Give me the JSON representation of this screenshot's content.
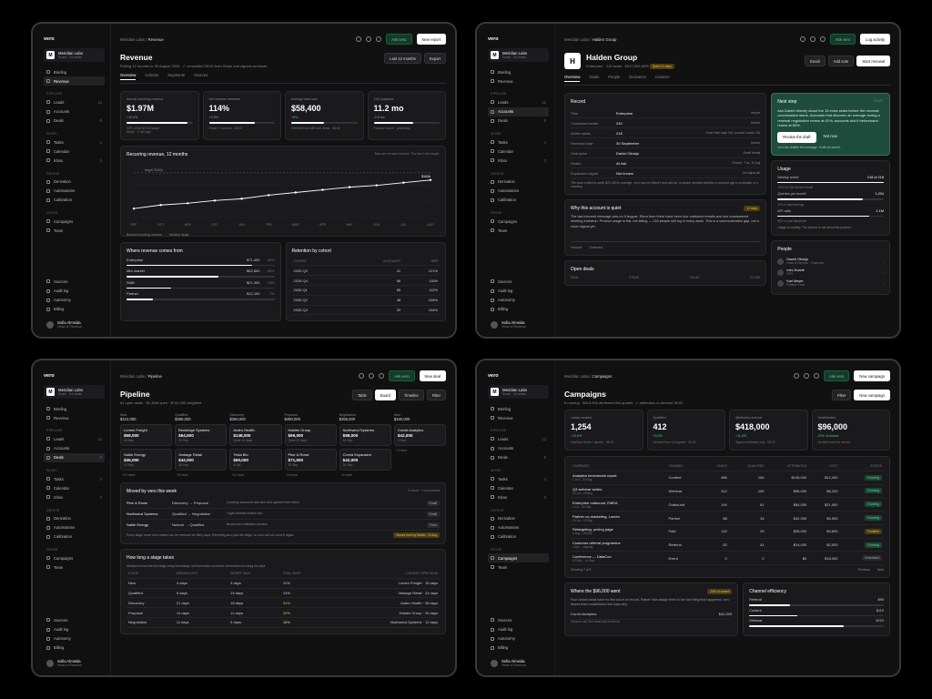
{
  "sidebar": {
    "logo": "vero",
    "workspace": "Meridian Labs",
    "workspace_sub": "Scale · 24 seats",
    "items_top": [
      {
        "label": "Briefing"
      },
      {
        "label": "Revenue"
      }
    ],
    "pipeline_label": "PIPELINE",
    "pipeline_items": [
      {
        "label": "Leads",
        "count": "12"
      },
      {
        "label": "Accounts",
        "count": ""
      },
      {
        "label": "Deals",
        "count": "8"
      }
    ],
    "work_label": "WORK",
    "work_items": [
      {
        "label": "Tasks",
        "count": "4"
      },
      {
        "label": "Calendar"
      },
      {
        "label": "Inbox",
        "count": "3"
      }
    ],
    "derive_label": "DERIVE",
    "derive_items": [
      {
        "label": "Derivation"
      },
      {
        "label": "Automations"
      },
      {
        "label": "Calibration"
      }
    ],
    "grow_label": "GROW",
    "grow_items": [
      {
        "label": "Campaigns"
      },
      {
        "label": "Team"
      }
    ],
    "bottom_items": [
      {
        "label": "Sources"
      },
      {
        "label": "Audit log"
      },
      {
        "label": "Autonomy"
      },
      {
        "label": "Billing"
      }
    ],
    "user_name": "Sofia Almeida",
    "user_role": "Head of Revenue"
  },
  "top": {
    "ask": "Ask vero"
  },
  "revenue": {
    "crumb_root": "Meridian Labs",
    "crumb": "Revenue",
    "new": "New report",
    "title": "Revenue",
    "subtitle": "Rolling 12 months to 30 August 2026",
    "reconciled": "reconciled 06:02 from Stripe and signed contracts",
    "range": "Last 12 months",
    "export": "Export",
    "tabs": [
      "Overview",
      "Cohorts",
      "Segments",
      "Sources"
    ],
    "kpis": [
      {
        "label": "Annual recurring revenue",
        "value": "$1.97M",
        "delta": "+12.4%",
        "foot": "Stripe · 2 min ago",
        "note": "92% of the $2.1M target",
        "fill": 0.92
      },
      {
        "label": "Net revenue retention",
        "value": "114%",
        "delta": "+2.6%",
        "foot": "Stripe + invoices · 06:02",
        "fill": 0.7
      },
      {
        "label": "Average deal size",
        "value": "$58,400",
        "delta": "+8%",
        "foot": "Derived from 286 won deals · 06:02",
        "fill": 0.5
      },
      {
        "label": "CAC payback",
        "value": "11.2 mo",
        "delta": "-0.8 mo",
        "foot": "Finance export · yesterday",
        "fill": 0.6
      }
    ],
    "chart_title": "Recurring revenue, 12 months",
    "chart_note": "Bars are revised revenue. The line is the target.",
    "legend_a": "Booked recurring revenue",
    "legend_b": "Monthly target",
    "target_label": "target $180k",
    "end_label": "$164k",
    "chart_data": {
      "type": "line",
      "categories": [
        "SEP",
        "OCT",
        "NOV",
        "DEC",
        "JAN",
        "FEB",
        "MAR",
        "APR",
        "MAY",
        "JUN",
        "JUL",
        "AUG"
      ],
      "values": [
        100,
        108,
        112,
        118,
        122,
        130,
        136,
        142,
        148,
        152,
        158,
        164
      ]
    },
    "where_title": "Where revenue comes from",
    "where": [
      {
        "name": "Enterprise",
        "value": "$71,400",
        "pct": "42%",
        "fill": 0.85
      },
      {
        "name": "Mid-market",
        "value": "$52,800",
        "pct": "33%",
        "fill": 0.62
      },
      {
        "name": "SMB",
        "value": "$21,300",
        "pct": "13%",
        "fill": 0.3
      },
      {
        "name": "Partner",
        "value": "$12,100",
        "pct": "7%",
        "fill": 0.18
      }
    ],
    "cohort_title": "Retention by cohort",
    "cohort_cols": [
      "COHORT",
      "ACCOUNTS",
      "NRR"
    ],
    "cohorts": [
      [
        "2025 Q3",
        "41",
        "121%"
      ],
      [
        "2025 Q4",
        "58",
        "116%"
      ],
      [
        "2026 Q1",
        "65",
        "112%"
      ],
      [
        "2026 Q2",
        "38",
        "108%"
      ],
      [
        "2026 Q3",
        "29",
        "104%"
      ]
    ]
  },
  "account": {
    "crumb_root": "Meridian Labs",
    "crumb": "Halden Group",
    "activity": "Log activity",
    "title": "Halden Group",
    "meta": "Enterprise · 218 seats · $312,000 ARR",
    "badge": "Quiet 12 days",
    "email": "Email",
    "note": "Add note",
    "renew": "Start renewal",
    "tabs": [
      "Overview",
      "Deals",
      "People",
      "Derivation",
      "Invoices"
    ],
    "record_title": "Record",
    "record": [
      {
        "k": "Plan",
        "v": "Enterprise",
        "s": "Invoice"
      },
      {
        "k": "Contracted seats",
        "v": "240",
        "s": "Invoice"
      },
      {
        "k": "Active seats",
        "v": "218",
        "s": "Order form says 240, product counts 218"
      },
      {
        "k": "Renewal date",
        "v": "30 September",
        "s": "Invoice"
      },
      {
        "k": "Champion",
        "v": "Daniel Okonjo",
        "s": "Email thread"
      },
      {
        "k": "Health",
        "v": "At risk",
        "s": "Flowed · Tue, 11 Aug"
      },
      {
        "k": "Expansion signal",
        "v": "Not known",
        "s": "No signal yet"
      }
    ],
    "record_note": "The seat conflict is worth $23,400 in overage. vero has not billed it and will not, a person decides whether a contract gap is a mistake or a courtesy.",
    "quiet_title": "Why this account is quiet",
    "quiet_badge": "12 days",
    "quiet_text": "The last inbound message was on 5 August. Since then there have been four outbound emails and one unanswered meeting invitation. Product usage is flat, not falling — 218 people still log in every week. This is a communication gap, not a churn signal yet.",
    "quiet_a": "Inbound",
    "quiet_b": "Outbound",
    "deals_title": "Open deals",
    "deals_cols": [
      "DEAL",
      "STAGE",
      "VALUE",
      "CLOSE"
    ],
    "next_title": "Next step",
    "next_tag": "DRAFT",
    "next_text": "Ask Daniel directly about the 15 extra seats before the renewal conversation starts. Accounts that discover an overage during a renewal negotiation renew at 61%; accounts told it beforehand renew at 83%.",
    "next_btn": "Review the draft",
    "next_btn2": "Not now",
    "next_foot": "vero has drafted the message. It will not send it.",
    "usage_title": "Usage",
    "usage": [
      {
        "k": "Weekly active",
        "v": "218 of 218",
        "n": "100% of 218 licensed seats",
        "fill": 1
      },
      {
        "k": "Queries per month",
        "v": "1,204",
        "n": "11% of past average",
        "fill": 0.8
      },
      {
        "k": "API calls",
        "v": "2.1M",
        "n": "86% of past allowance",
        "fill": 0.86
      }
    ],
    "usage_note": "Usage is healthy. The silence is not about the product.",
    "people_title": "People",
    "people": [
      {
        "n": "Daniel Okonjo",
        "r": "Head of RevOps · Champion"
      },
      {
        "n": "Ines Duarte",
        "r": "CFO"
      },
      {
        "n": "Karl Meyer",
        "r": "Platform Lead"
      }
    ]
  },
  "pipeline": {
    "crumb_root": "Meridian Labs",
    "crumb": "Pipeline",
    "new": "New deal",
    "title": "Pipeline",
    "subtitle": "61 open deals · $1.46M open · $744,000 weighted",
    "views": [
      "Table",
      "Board",
      "Timeline"
    ],
    "filter": "Filter",
    "cols": [
      {
        "h": "New",
        "v": "$410,000",
        "cards": [
          {
            "n": "Lumen Freight",
            "v": "$58,000",
            "m": "15 Sep"
          },
          {
            "n": "Sable Energy",
            "v": "$36,000",
            "m": "12 Sep"
          }
        ],
        "more": "+10 more"
      },
      {
        "h": "Qualified",
        "v": "$286,000",
        "cards": [
          {
            "n": "Beckridge Systems",
            "v": "$64,500",
            "m": "22 Sep"
          },
          {
            "n": "Vantage Retail",
            "v": "$42,000",
            "m": "28 Sep"
          }
        ],
        "more": "+8 more"
      },
      {
        "h": "Discovery",
        "v": "$366,000",
        "cards": [
          {
            "n": "Arden Health",
            "v": "$148,000",
            "m": "Quiet 16 days"
          },
          {
            "n": "Tesla Bio",
            "v": "$60,000",
            "m": "9 Oct"
          }
        ],
        "more": "+11 more"
      },
      {
        "h": "Proposal",
        "v": "$490,000",
        "cards": [
          {
            "n": "Halden Group",
            "v": "$99,000",
            "m": "Quiet 12 days"
          },
          {
            "n": "Pine & Rowe",
            "v": "$71,500",
            "m": "30 Sep"
          }
        ],
        "more": "+5 more"
      },
      {
        "h": "Negotiation",
        "v": "$356,000",
        "cards": [
          {
            "n": "Northwind Systems",
            "v": "$88,000",
            "m": "14 Sep"
          },
          {
            "n": "Corvid Expansion",
            "v": "$42,000",
            "m": "20 Sep"
          }
        ],
        "more": "+4 more"
      },
      {
        "h": "Won",
        "v": "$180,000",
        "cards": [
          {
            "n": "Corvid Analytics",
            "v": "$42,000",
            "m": "3 Sep"
          }
        ],
        "more": "+3 more"
      }
    ],
    "moved_title": "Moved by vero this week",
    "moved_meta": "3 moves · 1 unresolved",
    "moved": [
      {
        "n": "Pine & Rowe",
        "s": "Discovery → Proposal",
        "r": "A pricing document was sent and opened three times",
        "src": "Email"
      },
      {
        "n": "Northwind Systems",
        "s": "Qualified → Negotiation",
        "r": "Legal redlined section two",
        "src": "Email"
      },
      {
        "n": "Sable Energy",
        "s": "Nurture → Qualified",
        "r": "Booked an evaluation session",
        "src": "Form"
      }
    ],
    "moved_note": "Every stage move vero makes can be reversed for thirty days. Reverting also puts the stage, so vero will not move it again.",
    "moved_badge": "Moves held by Martin, 74 Aug",
    "stage_title": "How long a stage takes",
    "stage_sub": "Measured from the first stage entry timestamp, not from when someone remembered to drag the card.",
    "stage_cols": [
      "STAGE",
      "MEDIAN DAYS",
      "WORST DAYS",
      "STALL RATE",
      "LONGEST OPEN NOW"
    ],
    "stages": [
      [
        "New",
        "4 days",
        "3 days",
        "11%",
        "Lumen Freight · 16 days"
      ],
      [
        "Qualified",
        "9 days",
        "14 days",
        "14%",
        "Vantage Retail · 24 days"
      ],
      [
        "Discovery",
        "21 days",
        "18 days",
        "31%",
        "Arden Health · 36 days"
      ],
      [
        "Proposal",
        "14 days",
        "11 days",
        "22%",
        "Halden Group · 30 days"
      ],
      [
        "Negotiation",
        "11 days",
        "9 days",
        "18%",
        "Northwind Systems · 12 days"
      ]
    ]
  },
  "campaigns": {
    "crumb_root": "Meridian Labs",
    "crumb": "Campaigns",
    "new": "New campaign",
    "title": "Campaigns",
    "subtitle": "6 running · $418,000 attributed this quarter",
    "attr": "attribution re-derived 06:02",
    "filter": "Filter",
    "new2": "New campaign",
    "kpis": [
      {
        "l": "Leads created",
        "v": "1,254",
        "d": "+14.0%",
        "f": "HubSpot forms + Apollo · 06:02"
      },
      {
        "l": "Qualified",
        "v": "412",
        "d": "+8.2%",
        "f": "Derived from 14 signals · 06:02"
      },
      {
        "l": "Attributed revenue",
        "v": "$418,000",
        "d": "+11.4%",
        "f": "Signed contracts only · 06:02"
      },
      {
        "l": "Unattributed",
        "v": "$96,000",
        "d": "23% of closed",
        "f": "No first touch on record"
      }
    ],
    "cols": [
      "CAMPAIGN",
      "CHANNEL",
      "LEADS",
      "QUALIFIED",
      "ATTRIBUTED",
      "COST",
      "STATUS"
    ],
    "rows": [
      {
        "n": "Analytics benchmark report",
        "s": "1 Jun – 31 Aug",
        "c": "Content",
        "l": "486",
        "q": "164",
        "a": "$148,000",
        "co": "$12,400",
        "st": "Running"
      },
      {
        "n": "Q3 webinar series",
        "s": "14 Jul – 28 Aug",
        "c": "Webinar",
        "l": "312",
        "q": "109",
        "a": "$96,000",
        "co": "$8,200",
        "st": "Running"
      },
      {
        "n": "Enterprise outbound, EMEA",
        "s": "1 Jul – 30 Sep",
        "c": "Outbound",
        "l": "194",
        "q": "61",
        "a": "$84,000",
        "co": "$21,000",
        "st": "Running"
      },
      {
        "n": "Partner co-marketing, Lumen",
        "s": "15 Jul – 15 Sep",
        "c": "Partner",
        "l": "88",
        "q": "34",
        "a": "$42,000",
        "co": "$4,500",
        "st": "Running"
      },
      {
        "n": "Retargeting, pricing page",
        "s": "1 Aug – 15 Sep",
        "c": "Paid",
        "l": "142",
        "q": "25",
        "a": "$28,000",
        "co": "$9,600",
        "st": "Throttled"
      },
      {
        "n": "Customer referral programme",
        "s": "1 Apr – ongoing",
        "c": "Referral",
        "l": "62",
        "q": "41",
        "a": "$14,000",
        "co": "$2,000",
        "st": "Running"
      },
      {
        "n": "Conference — DataCon",
        "s": "12 Sep – 14 Sep",
        "c": "Event",
        "l": "0",
        "q": "0",
        "a": "$0",
        "co": "$18,000",
        "st": "Scheduled"
      }
    ],
    "page": "Showing 7 of 9",
    "prev": "Previous",
    "next": "Next",
    "went_title": "Where the $96,000 went",
    "went_badge": "23% of closed",
    "went_text": "Four closed deals have no first touch on record. Rather than assign them to the last thing that happened, vero leaves them unattributed and says why.",
    "went_row": "Corvid Analytics",
    "went_val": "$42,000",
    "went_sub": "Inbound call, first email lost at thread",
    "eff_title": "Channel efficiency",
    "eff": [
      {
        "n": "Referral",
        "v": "$95",
        "fill": 0.3
      },
      {
        "n": "Content",
        "v": "$110",
        "fill": 0.36
      },
      {
        "n": "Webinar",
        "v": "$222",
        "fill": 0.7
      }
    ]
  }
}
